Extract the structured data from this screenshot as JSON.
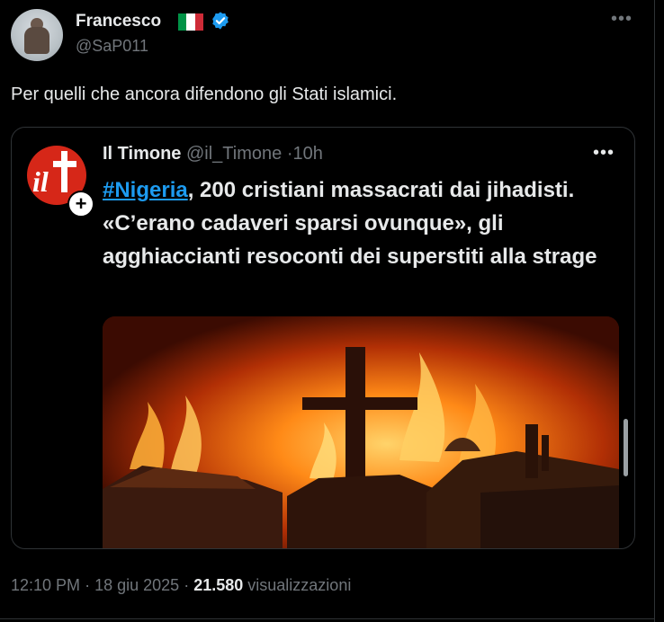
{
  "post": {
    "author_name": "Francesco",
    "author_handle": "@SaP011",
    "text": "Per quelli che ancora difendono gli Stati islamici.",
    "time": "12:10 PM",
    "separator": "·",
    "date": "18 giu 2025",
    "views_count": "21.580",
    "views_label": "visualizzazioni",
    "more_icon": "more-horizontal-icon",
    "flag": {
      "green": "#009246",
      "white": "#ffffff",
      "red": "#ce2b37"
    },
    "verified_color": "#1d9bf0"
  },
  "quote": {
    "author_name": "Il Timone",
    "author_handle": "@il_Timone",
    "separator": "·",
    "time": "10h",
    "hashtag": "#Nigeria",
    "text_rest": ", 200 cristiani massacrati dai jihadisti. «C’erano cadaveri sparsi ovunque», gli agghiaccianti resoconti dei superstiti alla strage",
    "avatar_color": "#d62718",
    "avatar_logo_text": "il",
    "follow_icon": "plus-icon"
  },
  "colors": {
    "background": "#000000",
    "text": "#e7e9ea",
    "secondary": "#71767b",
    "accent": "#1d9bf0",
    "border": "#2f3336"
  }
}
